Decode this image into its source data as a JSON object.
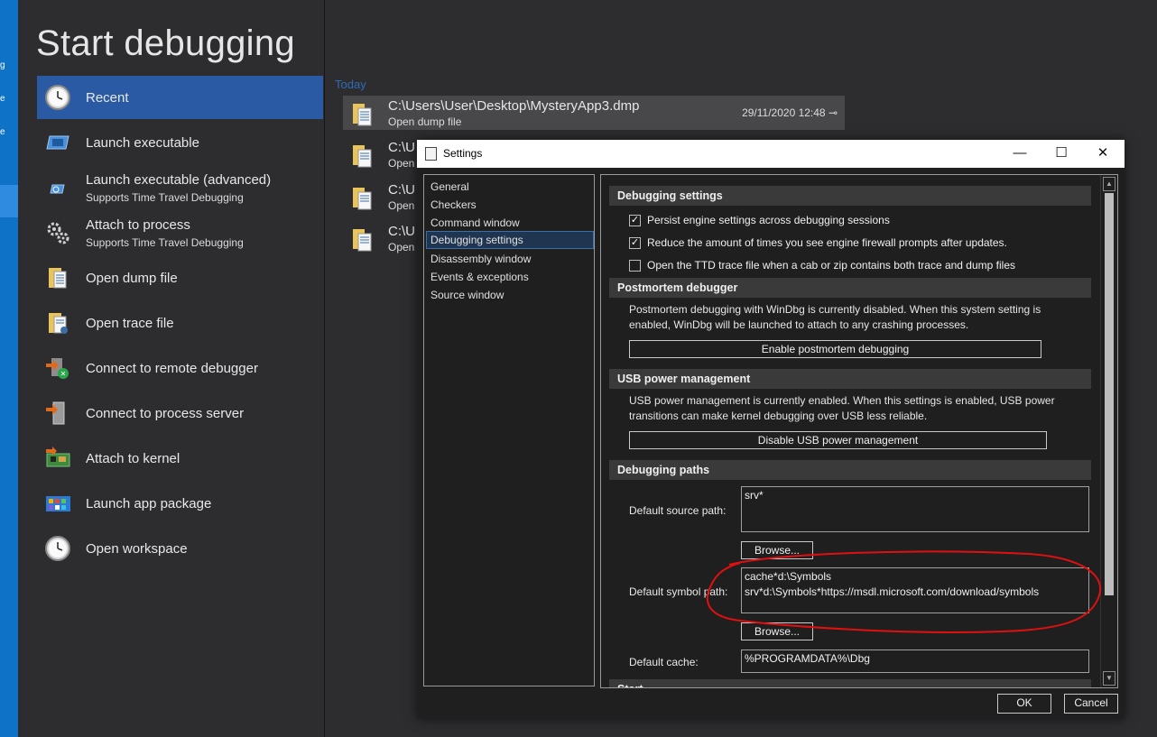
{
  "sidebar_strip": {
    "chars": [
      "g",
      "e",
      "e"
    ]
  },
  "page_title": "Start debugging",
  "menu": [
    {
      "label": "Recent",
      "sub": "",
      "icon": "clock-icon",
      "selected": true
    },
    {
      "label": "Launch executable",
      "sub": "",
      "icon": "launch-executable-icon"
    },
    {
      "label": "Launch executable (advanced)",
      "sub": "Supports Time Travel Debugging",
      "icon": "launch-advanced-icon"
    },
    {
      "label": "Attach to process",
      "sub": "Supports Time Travel Debugging",
      "icon": "gears-icon"
    },
    {
      "label": "Open dump file",
      "sub": "",
      "icon": "dump-file-icon"
    },
    {
      "label": "Open trace file",
      "sub": "",
      "icon": "trace-file-icon"
    },
    {
      "label": "Connect to remote debugger",
      "sub": "",
      "icon": "remote-debugger-icon"
    },
    {
      "label": "Connect to process server",
      "sub": "",
      "icon": "process-server-icon"
    },
    {
      "label": "Attach to kernel",
      "sub": "",
      "icon": "kernel-icon"
    },
    {
      "label": "Launch app package",
      "sub": "",
      "icon": "app-package-icon"
    },
    {
      "label": "Open workspace",
      "sub": "",
      "icon": "workspace-clock-icon"
    }
  ],
  "recent": {
    "group_label": "Today",
    "items": [
      {
        "path": "C:\\Users\\User\\Desktop\\MysteryApp3.dmp",
        "sub": "Open dump file",
        "date": "29/11/2020 12:48 ⊸",
        "selected": true
      },
      {
        "path": "C:\\U",
        "sub": "Open"
      },
      {
        "path": "C:\\U",
        "sub": "Open"
      },
      {
        "path": "C:\\U",
        "sub": "Open"
      }
    ]
  },
  "dialog": {
    "title": "Settings",
    "minimize": "—",
    "maximize": "☐",
    "close": "✕",
    "nav": [
      "General",
      "Checkers",
      "Command window",
      "Debugging settings",
      "Disassembly window",
      "Events & exceptions",
      "Source window"
    ],
    "nav_selected": "Debugging settings",
    "sections": {
      "debugging_settings": {
        "title": "Debugging settings",
        "checks": [
          {
            "label": "Persist engine settings across debugging sessions",
            "checked": true
          },
          {
            "label": "Reduce the amount of times you see engine firewall prompts after updates.",
            "checked": true
          },
          {
            "label": "Open the TTD trace file when a cab or zip contains both trace and dump files",
            "checked": false
          }
        ]
      },
      "postmortem": {
        "title": "Postmortem debugger",
        "text": "Postmortem debugging with WinDbg is currently disabled. When this system setting is enabled, WinDbg will be launched to attach to any crashing processes.",
        "button": "Enable postmortem debugging"
      },
      "usb": {
        "title": "USB power management",
        "text": "USB power management is currently enabled. When this settings is enabled, USB power transitions can make kernel debugging over USB less reliable.",
        "button": "Disable USB power management"
      },
      "paths": {
        "title": "Debugging paths",
        "source_label": "Default source path:",
        "source_value": "srv*",
        "browse": "Browse...",
        "symbol_label": "Default symbol path:",
        "symbol_value": "cache*d:\\Symbols\nsrv*d:\\Symbols*https://msdl.microsoft.com/download/symbols",
        "cache_label": "Default cache:",
        "cache_value": "%PROGRAMDATA%\\Dbg",
        "next_section_partial": "Start"
      }
    },
    "ok": "OK",
    "cancel": "Cancel"
  },
  "colors": {
    "accent": "#2b5aa4",
    "blue_strip": "#0e72c6",
    "annotation": "#e01010"
  }
}
